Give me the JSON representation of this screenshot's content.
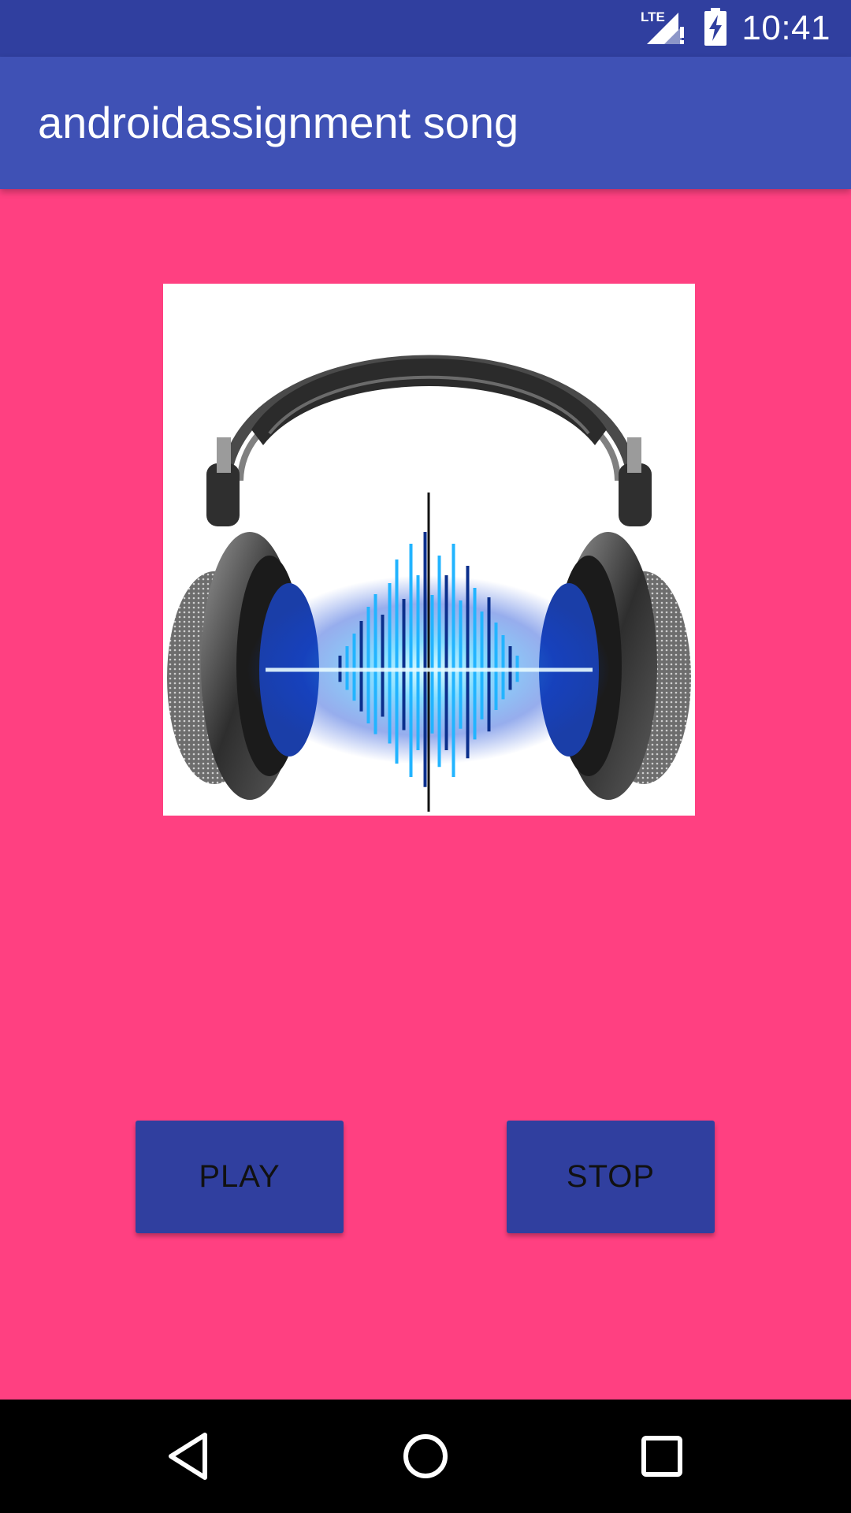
{
  "status_bar": {
    "network_label": "LTE",
    "time": "10:41",
    "icons": [
      "lte-signal-icon",
      "battery-charging-icon"
    ]
  },
  "app_bar": {
    "title": "androidassignment song"
  },
  "artwork": {
    "icon": "headphones-soundwave-image"
  },
  "controls": {
    "play_label": "PLAY",
    "stop_label": "STOP"
  },
  "nav_bar": {
    "icons": [
      "back-icon",
      "home-icon",
      "recents-icon"
    ]
  },
  "colors": {
    "status_bar": "#303f9f",
    "app_bar": "#3f51b5",
    "background": "#ff4081",
    "button": "#303f9f",
    "nav_bar": "#000000"
  }
}
